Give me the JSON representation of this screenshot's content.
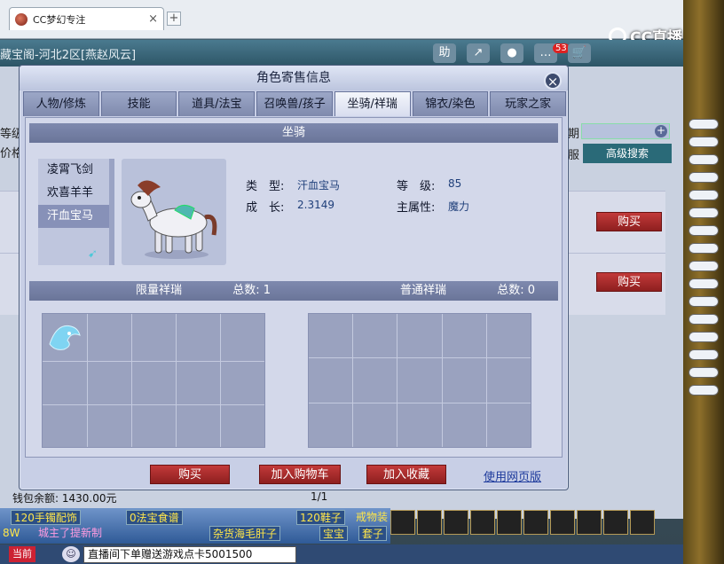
{
  "browser": {
    "tab_title": "CC梦幻专注",
    "new_tab": "+",
    "close": "×"
  },
  "cc_logo": "CC直播",
  "background_window": {
    "title": "藏宝阁-河北2区[燕赵风云]",
    "icons": [
      "助",
      "↗",
      "●",
      "…",
      "🛒"
    ],
    "badge": "53",
    "label_grade": "等级",
    "label_price": "价格",
    "label_period": "期",
    "label_service": "服",
    "advanced_search": "高级搜索",
    "buy_label": "购买",
    "wallet": "钱包余额: 1430.00元",
    "pager": "1/1"
  },
  "dialog": {
    "title": "角色寄售信息",
    "close": "×",
    "tabs": [
      {
        "label": "人物/修炼",
        "active": false
      },
      {
        "label": "技能",
        "active": false
      },
      {
        "label": "道具/法宝",
        "active": false
      },
      {
        "label": "召唤兽/孩子",
        "active": false
      },
      {
        "label": "坐骑/祥瑞",
        "active": true
      },
      {
        "label": "锦衣/染色",
        "active": false
      },
      {
        "label": "玩家之家",
        "active": false
      }
    ],
    "mount_section": "坐骑",
    "mounts": [
      {
        "name": "凌霄飞剑",
        "selected": false
      },
      {
        "name": "欢喜羊羊",
        "selected": false
      },
      {
        "name": "汗血宝马",
        "selected": true
      }
    ],
    "attributes": {
      "type_key": "类　型:",
      "type_val": "汗血宝马",
      "level_key": "等　级:",
      "level_val": "85",
      "growth_key": "成　长:",
      "growth_val": "2.3149",
      "main_attr_key": "主属性:",
      "main_attr_val": "魔力"
    },
    "limited": {
      "title": "限量祥瑞",
      "count_label": "总数: 1",
      "count": 1
    },
    "normal": {
      "title": "普通祥瑞",
      "count_label": "总数: 0",
      "count": 0
    },
    "buttons": {
      "buy": "购买",
      "add_cart": "加入购物车",
      "add_fav": "加入收藏",
      "web_version": "使用网页版"
    }
  },
  "game_bar": {
    "chips": [
      "120手镯配饰",
      "0法宝食谱",
      "120鞋子",
      "戒物装",
      "8W",
      "城主了提新制",
      "杂货海毛肝子",
      "宝宝",
      "套子"
    ],
    "current_channel": "当前",
    "chat_input": "直播间下单赠送游戏点卡5001500"
  },
  "colors": {
    "dialog_bg": "#c8cfe6",
    "section_head": "#7480a6",
    "buy_red": "#a72a2a",
    "link": "#1d3a9c"
  }
}
